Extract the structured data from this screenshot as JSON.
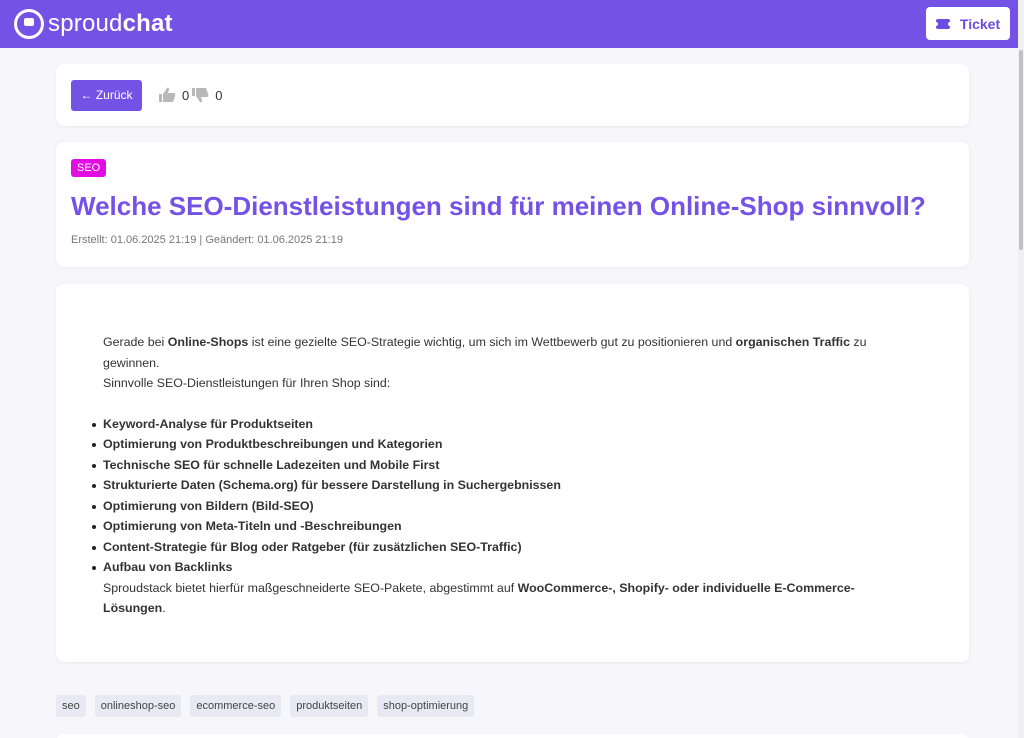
{
  "header": {
    "logo_light": "sproud",
    "logo_bold": "chat",
    "ticket_label": "Ticket",
    "ticket_icon": "ticket-icon",
    "brand_color": "#7552e6"
  },
  "actions": {
    "back_label": "← Zurück",
    "thumbs_up_icon": "thumbs-up-icon",
    "thumbs_up_count": "0",
    "thumbs_down_icon": "thumbs-down-icon",
    "thumbs_down_count": "0"
  },
  "article": {
    "category": "SEO",
    "category_color": "#e20de2",
    "title": "Welche SEO-Dienstleistungen sind für meinen Online-Shop sinnvoll?",
    "meta": "Erstellt: 01.06.2025 21:19 | Geändert: 01.06.2025 21:19",
    "intro_1": "Gerade bei ",
    "intro_bold_1": "Online-Shops",
    "intro_2": " ist eine gezielte SEO-Strategie wichtig, um sich im Wettbewerb gut zu positionieren und ",
    "intro_bold_2": "organischen Traffic",
    "intro_3": " zu gewinnen.",
    "intro_line2": "Sinnvolle SEO-Dienstleistungen für Ihren Shop sind:",
    "features": [
      "Keyword-Analyse für Produktseiten",
      "Optimierung von Produktbeschreibungen und Kategorien",
      "Technische SEO für schnelle Ladezeiten und Mobile First",
      "Strukturierte Daten (Schema.org) für bessere Darstellung in Suchergebnissen",
      "Optimierung von Bildern (Bild-SEO)",
      "Optimierung von Meta-Titeln und -Beschreibungen",
      "Content-Strategie für Blog oder Ratgeber (für zusätzlichen SEO-Traffic)",
      "Aufbau von Backlinks"
    ],
    "closing_1": "Sproudstack bietet hierfür maßgeschneiderte SEO-Pakete, abgestimmt auf ",
    "closing_bold": "WooCommerce-, Shopify- oder individuelle E-Commerce-Lösungen",
    "closing_2": "."
  },
  "tags": [
    "seo",
    "onlineshop-seo",
    "ecommerce-seo",
    "produktseiten",
    "shop-optimierung"
  ]
}
